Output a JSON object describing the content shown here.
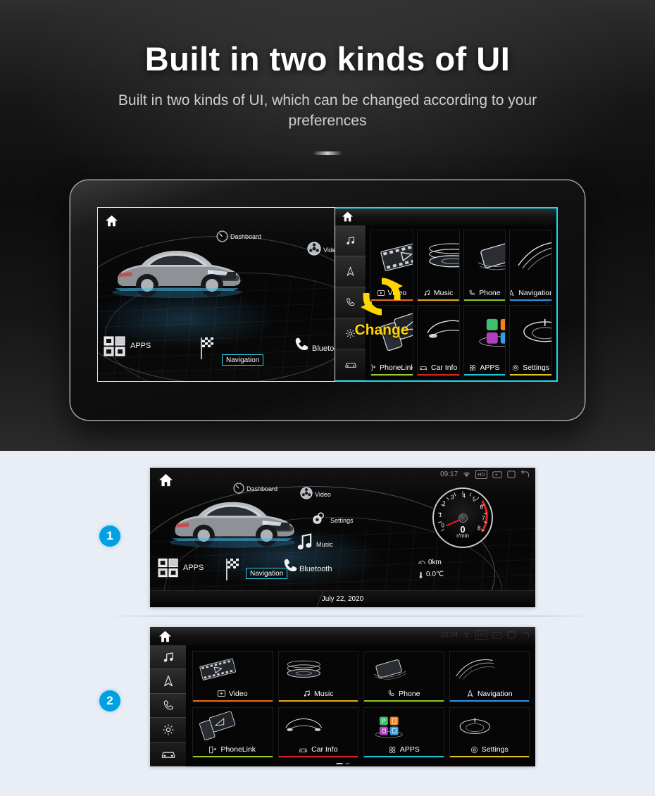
{
  "hero": {
    "title": "Built in two kinds of UI",
    "subtitle": "Built in two kinds of UI, which can be changed according to your preferences"
  },
  "change_badge": {
    "label": "Change",
    "icon": "refresh-swap-icon",
    "color": "#ffd400"
  },
  "colors": {
    "accent_cyan": "#21d7ec",
    "badge_blue": "#00a0e2",
    "change_yellow": "#ffd400",
    "panel_bg": "#e9edf5",
    "nav_chip_border": "#2ad3ef"
  },
  "device": {
    "left_panel": {
      "name": "car-home-ui",
      "home_icon": "home-icon",
      "items": [
        {
          "label": "Dashboard",
          "icon": "gauge-icon"
        },
        {
          "label": "Video",
          "icon": "film-reel-icon"
        },
        {
          "label": "Navigation",
          "icon": "checkered-flag-icon",
          "selected": true
        },
        {
          "label": "Bluetooth",
          "icon": "phone-handset-icon"
        },
        {
          "label": "APPS",
          "icon": "grid-squares-icon"
        }
      ]
    },
    "right_panel": {
      "name": "tile-grid-ui",
      "home_icon": "home-icon",
      "sidebar": [
        {
          "icon": "music-note-icon",
          "name": "music"
        },
        {
          "icon": "navigation-arrow-icon",
          "name": "navigation"
        },
        {
          "icon": "phone-handset-icon",
          "name": "phone"
        },
        {
          "icon": "gear-icon",
          "name": "settings"
        },
        {
          "icon": "car-front-icon",
          "name": "car-info"
        }
      ],
      "tiles": [
        {
          "label": "Video",
          "icon": "video-icon",
          "accent": "#e06a1c"
        },
        {
          "label": "Music",
          "icon": "music-note-icon",
          "accent": "#e0a51c"
        },
        {
          "label": "Phone",
          "icon": "phone-icon",
          "accent": "#8fc021"
        },
        {
          "label": "Navigation",
          "icon": "navigation-icon",
          "accent": "#2d8fe0"
        },
        {
          "label": "PhoneLink",
          "icon": "phonelink-icon",
          "accent": "#9ccc22"
        },
        {
          "label": "Car Info",
          "icon": "car-front-icon",
          "accent": "#d62424"
        },
        {
          "label": "APPS",
          "icon": "apps-icon",
          "accent": "#19c6d4"
        },
        {
          "label": "Settings",
          "icon": "gear-icon",
          "accent": "#e0c21c"
        }
      ]
    }
  },
  "shots": [
    {
      "badge": "1",
      "name": "screenshot-car-home",
      "status": {
        "time": "09:17",
        "wifi": "wifi-icon",
        "hd": "HD",
        "cast": "cast-icon",
        "recents": "square-icon",
        "back": "back-arrow-icon"
      },
      "home_icon": "home-icon",
      "items": [
        {
          "label": "Dashboard",
          "icon": "gauge-icon"
        },
        {
          "label": "Video",
          "icon": "film-reel-icon"
        },
        {
          "label": "Settings",
          "icon": "gear-icon"
        },
        {
          "label": "Music",
          "icon": "music-note-icon"
        },
        {
          "label": "Bluetooth",
          "icon": "phone-handset-icon"
        },
        {
          "label": "APPS",
          "icon": "grid-squares-icon"
        },
        {
          "label": "Navigation",
          "icon": "checkered-flag-icon",
          "selected": true
        }
      ],
      "tach": {
        "ticks": [
          "0",
          "1",
          "2",
          "3",
          "4",
          "5",
          "6",
          "7",
          "8"
        ],
        "value": "0",
        "unit": "r/min",
        "redline_from": 6
      },
      "readouts": [
        {
          "icon": "odometer-icon",
          "value": "0km"
        },
        {
          "icon": "thermometer-icon",
          "value": "0.0℃"
        }
      ],
      "date": "July 22, 2020"
    },
    {
      "badge": "2",
      "name": "screenshot-tile-grid",
      "status": {
        "time": "10:04",
        "wifi": "wifi-icon",
        "hd": "HD",
        "cast": "cast-icon",
        "recents": "square-icon",
        "back": "back-arrow-icon"
      },
      "home_icon": "home-icon",
      "sidebar": [
        {
          "icon": "music-note-icon",
          "name": "music"
        },
        {
          "icon": "navigation-arrow-icon",
          "name": "navigation"
        },
        {
          "icon": "phone-handset-icon",
          "name": "phone"
        },
        {
          "icon": "gear-icon",
          "name": "settings"
        },
        {
          "icon": "car-front-icon",
          "name": "car-info"
        }
      ],
      "tiles": [
        {
          "label": "Video",
          "icon": "video-icon",
          "accent": "#e06a1c"
        },
        {
          "label": "Music",
          "icon": "music-note-icon",
          "accent": "#e0a51c"
        },
        {
          "label": "Phone",
          "icon": "phone-icon",
          "accent": "#8fc021"
        },
        {
          "label": "Navigation",
          "icon": "navigation-icon",
          "accent": "#2d8fe0"
        },
        {
          "label": "PhoneLink",
          "icon": "phonelink-icon",
          "accent": "#9ccc22"
        },
        {
          "label": "Car Info",
          "icon": "car-front-icon",
          "accent": "#d62424"
        },
        {
          "label": "APPS",
          "icon": "apps-icon",
          "accent": "#19c6d4"
        },
        {
          "label": "Settings",
          "icon": "gear-icon",
          "accent": "#e0c21c"
        }
      ],
      "apps_tiles": [
        {
          "name": "parking-app",
          "color": "#3fbf6e",
          "glyph": "P"
        },
        {
          "name": "fuel-app",
          "color": "#f08020",
          "glyph": "⛽"
        },
        {
          "name": "video-app",
          "color": "#b03fc0",
          "glyph": "▶"
        },
        {
          "name": "store-app",
          "color": "#2f9fe0",
          "glyph": "☷"
        }
      ]
    }
  ]
}
